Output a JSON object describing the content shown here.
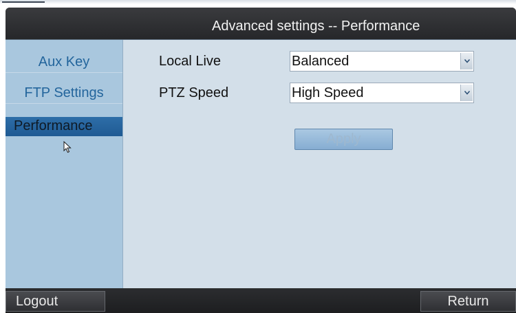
{
  "window": {
    "title": "Advanced settings -- Performance"
  },
  "sidebar": {
    "items": [
      {
        "label": "Aux Key",
        "selected": false
      },
      {
        "label": "FTP Settings",
        "selected": false
      },
      {
        "label": "Performance",
        "selected": true
      }
    ]
  },
  "form": {
    "local_live": {
      "label": "Local Live",
      "value": "Balanced"
    },
    "ptz_speed": {
      "label": "PTZ Speed",
      "value": "High Speed"
    },
    "apply_label": "Apply"
  },
  "footer": {
    "logout_label": "Logout",
    "return_label": "Return"
  },
  "icons": {
    "dropdown": "chevron-down-icon",
    "cursor": "mouse-pointer-icon"
  },
  "colors": {
    "sidebar_bg": "#a9c7de",
    "sidebar_text": "#23659c",
    "selected_bg": "#1f5a93",
    "content_bg": "#d3dfe9",
    "titlebar_bg": "#2a2b2d"
  }
}
